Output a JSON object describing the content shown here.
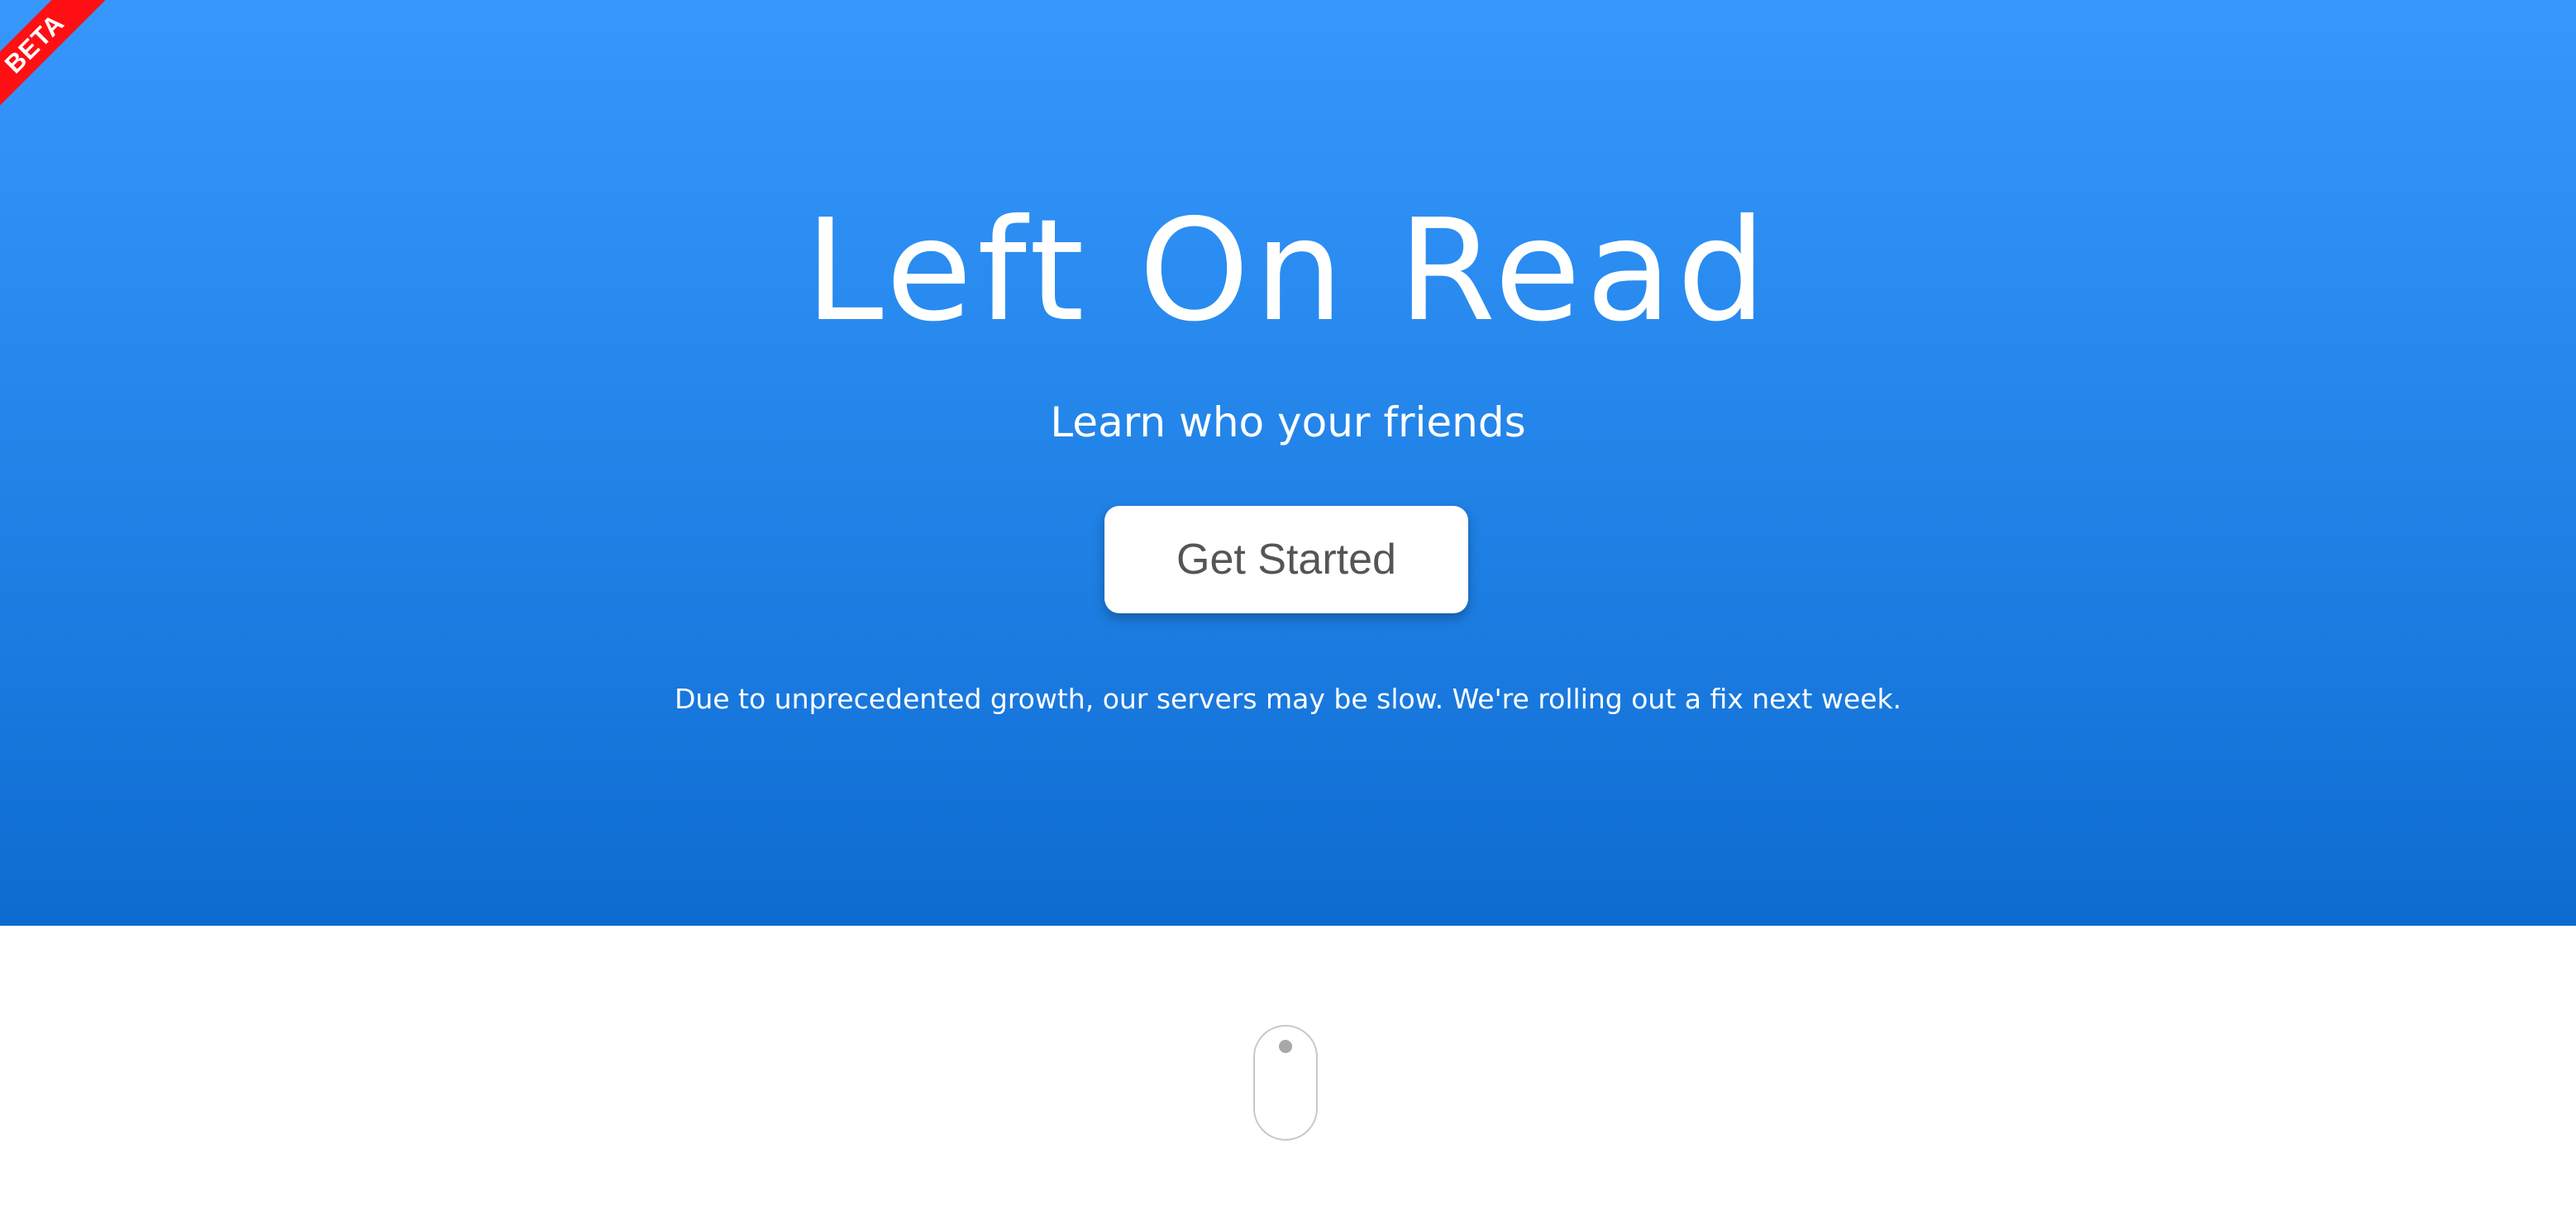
{
  "ribbon": {
    "label": "BETA",
    "color": "#ff0f14"
  },
  "hero": {
    "title": "Left On Read",
    "subtitle": "Learn who your friends",
    "cta_label": "Get Started",
    "notice": "Due to unprecedented growth, our servers may be slow. We're rolling out a fix next week.",
    "gradient_top": "#3697fd",
    "gradient_bottom": "#0d6bd0"
  },
  "scroll_indicator": {
    "icon": "mouse-scroll-icon"
  }
}
